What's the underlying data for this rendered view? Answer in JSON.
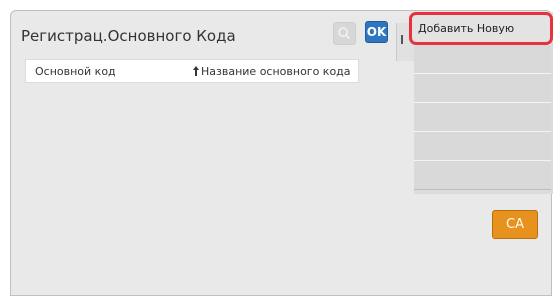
{
  "window": {
    "title": "Регистрац.Основного Кода"
  },
  "toolbar": {
    "ok_label": "OK",
    "search_icon": "search-icon"
  },
  "table": {
    "columns": [
      "Основной код",
      "Название основного кода"
    ],
    "sort_icon": "sort-arrow-up-icon",
    "rows": []
  },
  "side_menu": {
    "add_new_label": "Добавить Новую",
    "empty_slots": 5
  },
  "footer": {
    "ca_label": "CA"
  },
  "colors": {
    "accent_ok": "#2f76c0",
    "highlight": "#e8313f",
    "ca_button": "#e7921e"
  }
}
